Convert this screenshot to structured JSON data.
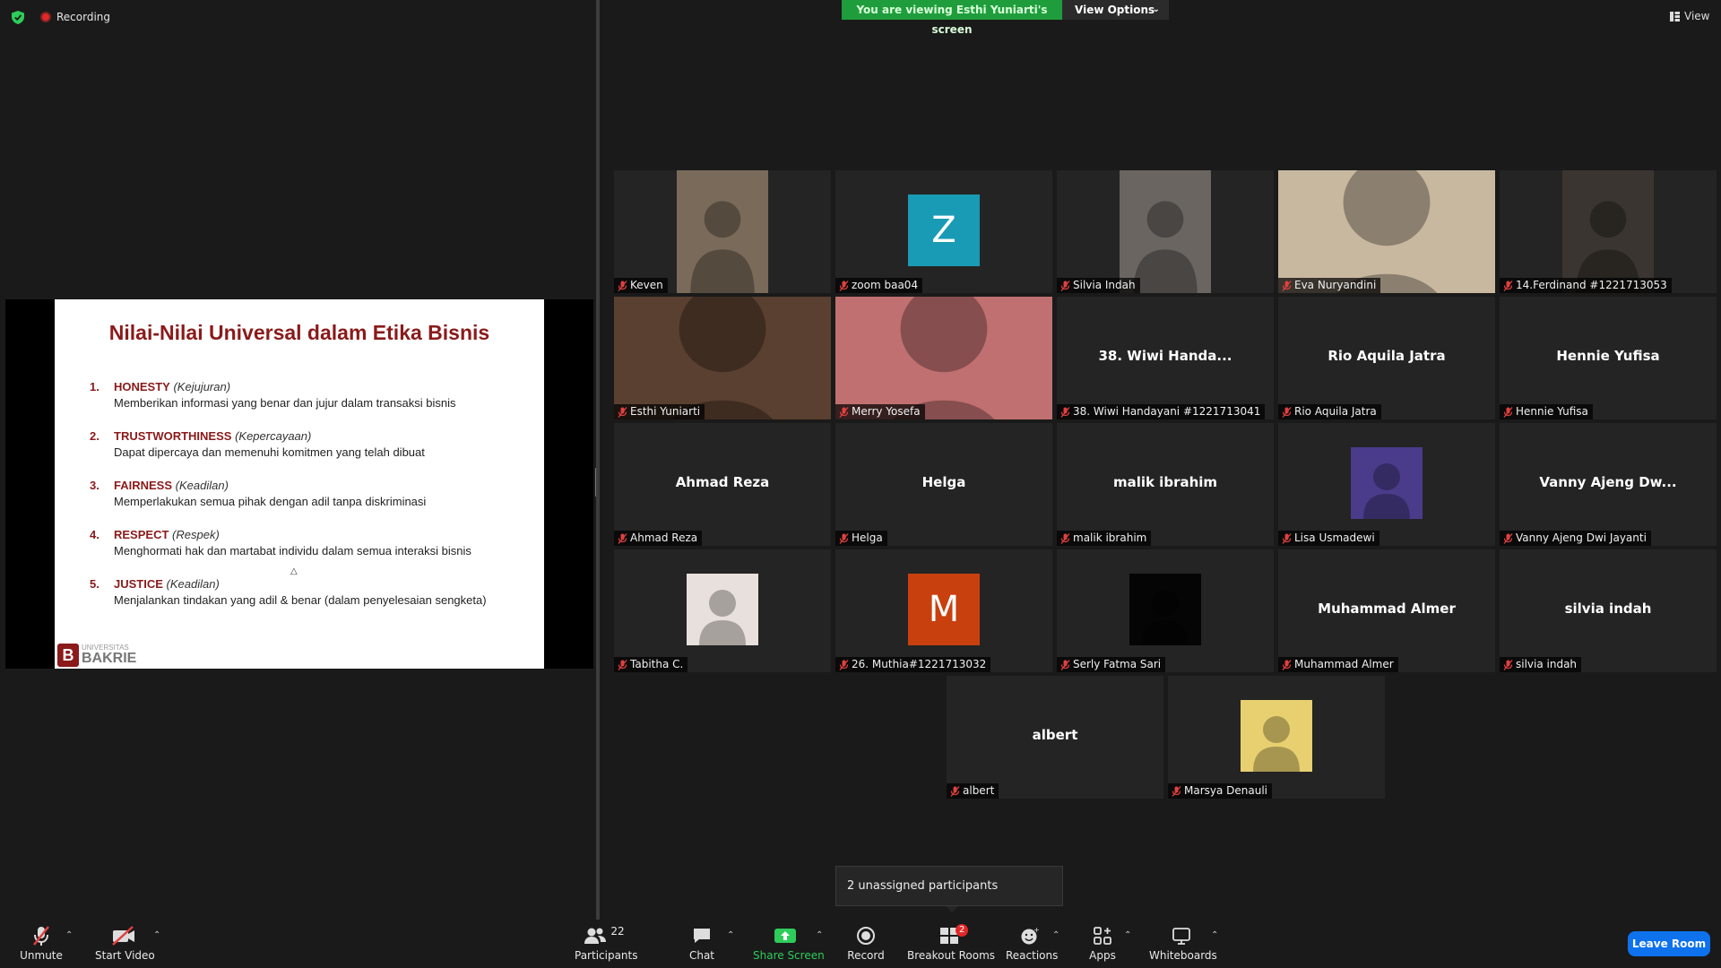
{
  "topbar": {
    "recording_label": "Recording",
    "viewing_banner": "You are viewing Esthi Yuniarti's screen",
    "view_options_label": "View Options",
    "view_label": "View"
  },
  "slide": {
    "title": "Nilai-Nilai Universal dalam Etika Bisnis",
    "items": [
      {
        "num": "1.",
        "head": "HONESTY",
        "sub": "(Kejujuran)",
        "desc": "Memberikan informasi yang benar dan jujur dalam transaksi bisnis"
      },
      {
        "num": "2.",
        "head": "TRUSTWORTHINESS",
        "sub": "(Kepercayaan)",
        "desc": "Dapat dipercaya dan memenuhi komitmen yang telah dibuat"
      },
      {
        "num": "3.",
        "head": "FAIRNESS",
        "sub": "(Keadilan)",
        "desc": "Memperlakukan semua pihak dengan adil tanpa diskriminasi"
      },
      {
        "num": "4.",
        "head": "RESPECT",
        "sub": "(Respek)",
        "desc": "Menghormati hak dan martabat individu dalam semua interaksi bisnis"
      },
      {
        "num": "5.",
        "head": "JUSTICE",
        "sub": "(Keadilan)",
        "desc": "Menjalankan tindakan yang adil & benar (dalam penyelesaian sengketa)"
      }
    ],
    "logo_small": "UNIVERSITAS",
    "logo_big": "BAKRIE",
    "logo_mark": "B"
  },
  "participants": [
    {
      "name": "Keven",
      "type": "video"
    },
    {
      "name": "zoom baa04",
      "type": "letter",
      "letter": "Z",
      "color": "#1a9bb5"
    },
    {
      "name": "Silvia Indah",
      "type": "video"
    },
    {
      "name": "Eva Nuryandini",
      "type": "video"
    },
    {
      "name": "14.Ferdinand #1221713053",
      "type": "video"
    },
    {
      "name": "Esthi Yuniarti",
      "type": "video",
      "active": true
    },
    {
      "name": "Merry Yosefa",
      "type": "video"
    },
    {
      "name": "38. Wiwi Handayani #1221713041",
      "type": "text",
      "display": "38. Wiwi Handa..."
    },
    {
      "name": "Rio Aquila Jatra",
      "type": "text",
      "display": "Rio Aquila Jatra"
    },
    {
      "name": "Hennie Yufisa",
      "type": "text",
      "display": "Hennie Yufisa"
    },
    {
      "name": "Ahmad Reza",
      "type": "text",
      "display": "Ahmad Reza"
    },
    {
      "name": "Helga",
      "type": "text",
      "display": "Helga"
    },
    {
      "name": "malik ibrahim",
      "type": "text",
      "display": "malik ibrahim"
    },
    {
      "name": "Lisa Usmadewi",
      "type": "photo"
    },
    {
      "name": "Vanny Ajeng Dwi Jayanti",
      "type": "text",
      "display": "Vanny Ajeng Dw..."
    },
    {
      "name": "Tabitha C.",
      "type": "photo"
    },
    {
      "name": "26. Muthia#1221713032",
      "type": "letter",
      "letter": "M",
      "color": "#c8400e"
    },
    {
      "name": "Serly Fatma Sari",
      "type": "photo"
    },
    {
      "name": "Muhammad Almer",
      "type": "text",
      "display": "Muhammad Almer"
    },
    {
      "name": "silvia indah",
      "type": "text",
      "display": "silvia indah"
    },
    {
      "name": "albert",
      "type": "text",
      "display": "albert"
    },
    {
      "name": "Marsya Denauli",
      "type": "photo"
    }
  ],
  "tooltip": "2 unassigned participants",
  "toolbar": {
    "unmute": "Unmute",
    "start_video": "Start Video",
    "participants": "Participants",
    "participant_count": "22",
    "chat": "Chat",
    "share_screen": "Share Screen",
    "record": "Record",
    "breakout_rooms": "Breakout Rooms",
    "breakout_badge": "2",
    "reactions": "Reactions",
    "apps": "Apps",
    "whiteboards": "Whiteboards",
    "leave_room": "Leave Room"
  },
  "colors": {
    "accent_green": "#1f9d3c",
    "active_speaker": "#e8d84a",
    "leave_blue": "#0e72ed",
    "mic_red": "#e04040",
    "slide_title": "#8b1a1a"
  }
}
